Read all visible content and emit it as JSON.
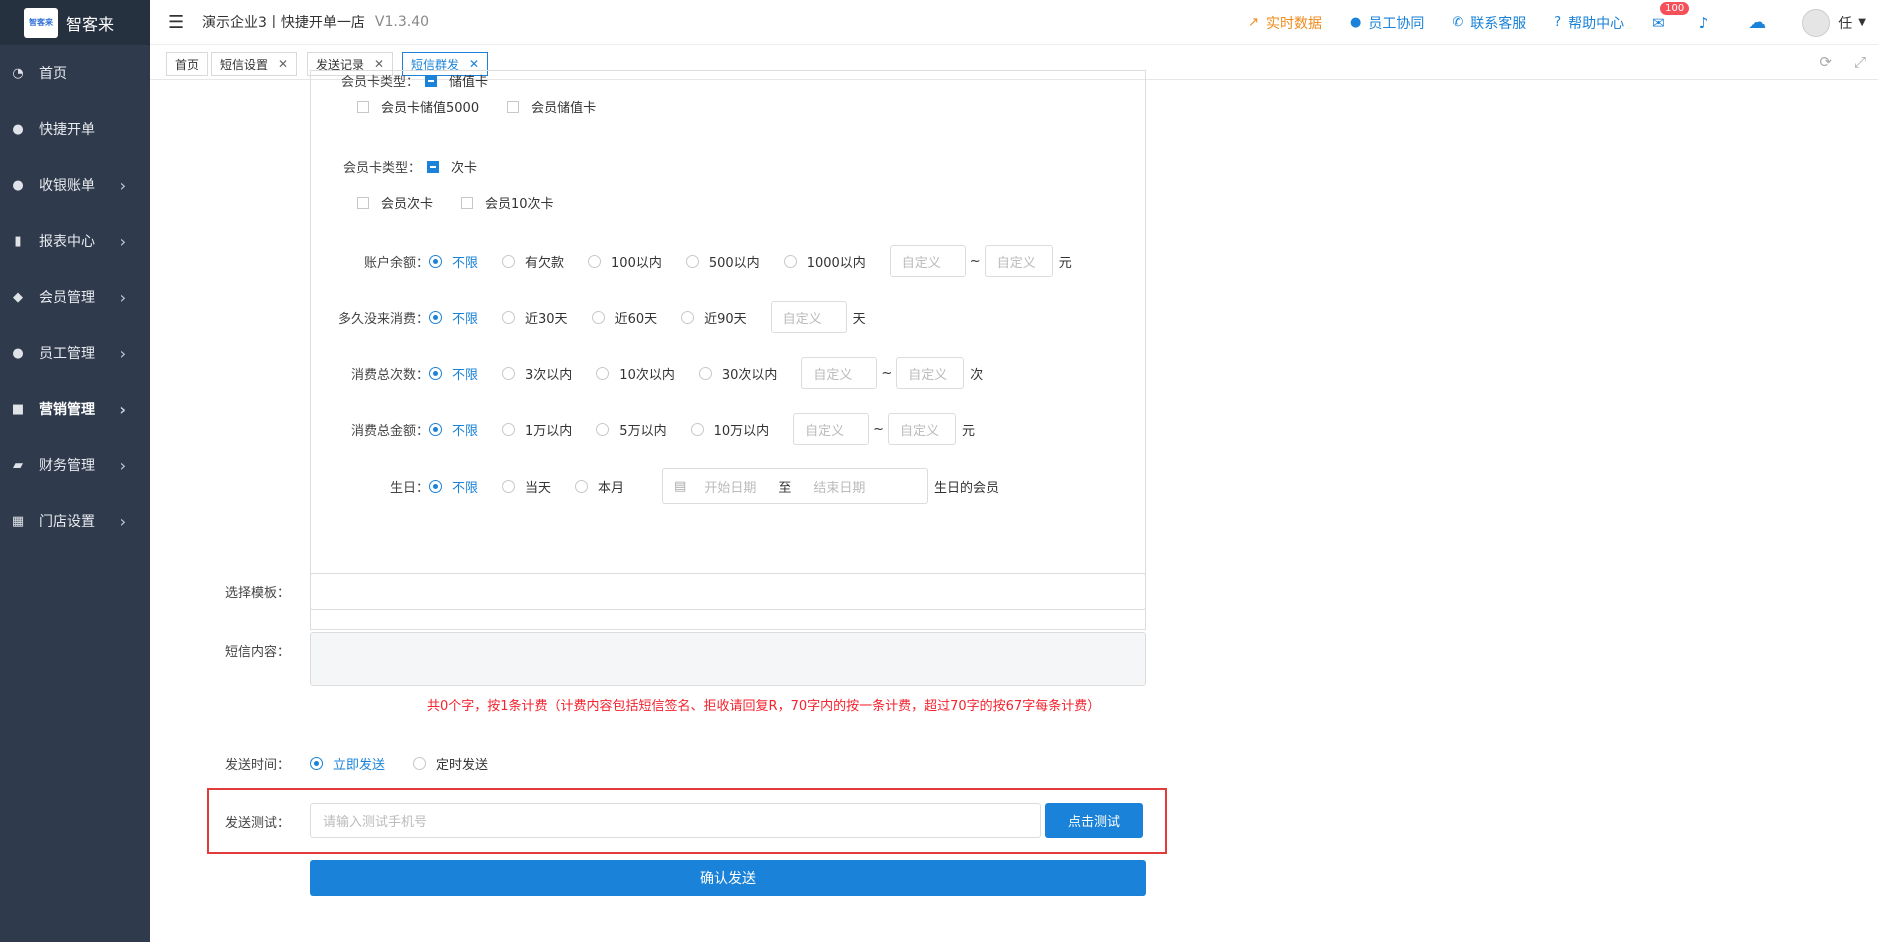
{
  "app": {
    "logo_text": "智客来",
    "logo_small": "智客来",
    "company": "演示企业3丨快捷开单一店",
    "version": "V1.3.40"
  },
  "sidebar": {
    "items": [
      {
        "label": "首页",
        "icon": "dashboard-icon"
      },
      {
        "label": "快捷开单",
        "icon": "money-bag-icon"
      },
      {
        "label": "收银账单",
        "icon": "money-bag-icon"
      },
      {
        "label": "报表中心",
        "icon": "bar-chart-icon"
      },
      {
        "label": "会员管理",
        "icon": "diamond-icon"
      },
      {
        "label": "员工管理",
        "icon": "user-icon"
      },
      {
        "label": "营销管理",
        "icon": "briefcase-icon"
      },
      {
        "label": "财务管理",
        "icon": "wallet-icon"
      },
      {
        "label": "门店设置",
        "icon": "grid-icon"
      }
    ]
  },
  "header": {
    "realtime": "实时数据",
    "staff_collab": "员工协同",
    "contact": "联系客服",
    "help": "帮助中心",
    "mail_badge": "100",
    "user": "任"
  },
  "tabs": [
    {
      "label": "首页"
    },
    {
      "label": "短信设置"
    },
    {
      "label": "发送记录"
    },
    {
      "label": "短信群发"
    }
  ],
  "filters": {
    "partial_top_label": "会员卡类型：",
    "partial_top_value": "储值卡",
    "stored_cards": [
      "会员卡储值5000",
      "会员储值卡"
    ],
    "card_type_label": "会员卡类型：",
    "card_type_value": "次卡",
    "times_cards": [
      "会员次卡",
      "会员10次卡"
    ],
    "balance": {
      "label": "账户余额：",
      "options": [
        "不限",
        "有欠款",
        "100以内",
        "500以内",
        "1000以内"
      ],
      "custom1": "自定义",
      "custom2": "自定义",
      "tilde": "~",
      "unit": "元"
    },
    "last_consume": {
      "label": "多久没来消费：",
      "options": [
        "不限",
        "近30天",
        "近60天",
        "近90天"
      ],
      "custom": "自定义",
      "unit": "天"
    },
    "consume_count": {
      "label": "消费总次数：",
      "options": [
        "不限",
        "3次以内",
        "10次以内",
        "30次以内"
      ],
      "custom1": "自定义",
      "custom2": "自定义",
      "tilde": "~",
      "unit": "次"
    },
    "consume_amount": {
      "label": "消费总金额：",
      "options": [
        "不限",
        "1万以内",
        "5万以内",
        "10万以内"
      ],
      "custom1": "自定义",
      "custom2": "自定义",
      "tilde": "~",
      "unit": "元"
    },
    "birthday": {
      "label": "生日：",
      "options": [
        "不限",
        "当天",
        "本月"
      ],
      "start": "开始日期",
      "to": "至",
      "end": "结束日期",
      "suffix": "生日的会员"
    }
  },
  "form": {
    "template_label": "选择模板：",
    "content_label": "短信内容：",
    "hint": "共0个字，按1条计费（计费内容包括短信签名、拒收请回复R，70字内的按一条计费，超过70字的按67字每条计费）",
    "send_time_label": "发送时间：",
    "send_now": "立即发送",
    "send_scheduled": "定时发送",
    "test_label": "发送测试：",
    "test_placeholder": "请输入测试手机号",
    "test_button": "点击测试",
    "confirm_button": "确认发送"
  },
  "colors": {
    "accent": "#1a82d8",
    "sidebar": "#2f3b4c",
    "warning": "#f5222d",
    "highlight_box": "#e23b3b"
  }
}
